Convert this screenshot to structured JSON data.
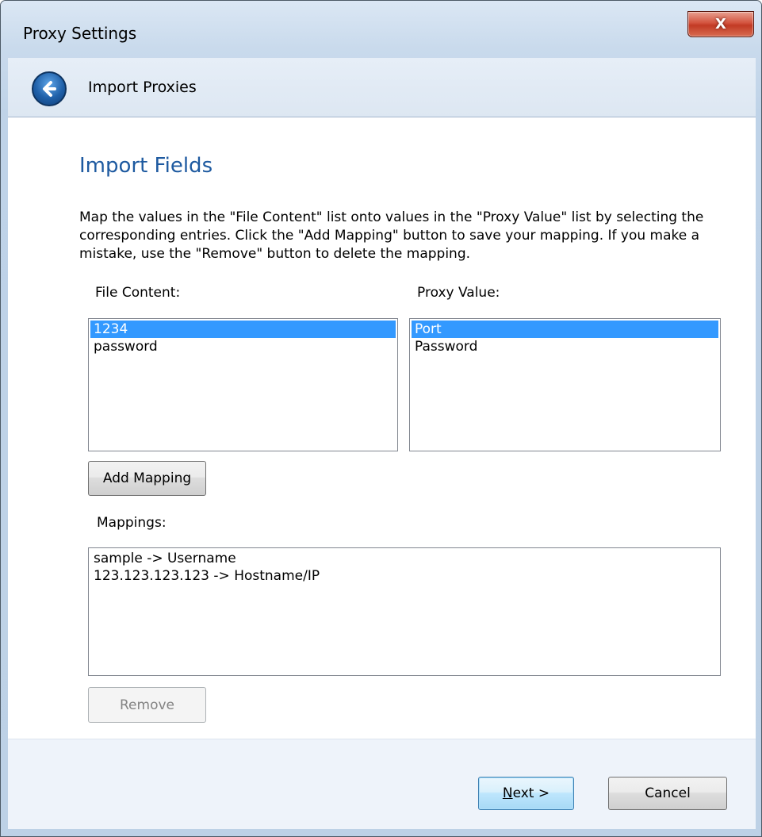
{
  "window": {
    "title": "Proxy Settings",
    "close_label": "X"
  },
  "nav": {
    "title": "Import Proxies",
    "back_icon": "back-arrow-icon"
  },
  "page": {
    "heading": "Import Fields",
    "description": "Map the values in the \"File Content\" list onto values in the \"Proxy Value\" list by selecting the corresponding entries. Click the \"Add Mapping\" button to save your mapping. If you make a mistake, use the \"Remove\" button to delete the mapping."
  },
  "file_content": {
    "label": "File Content:",
    "items": [
      "1234",
      "password"
    ],
    "selected_index": 0
  },
  "proxy_value": {
    "label": "Proxy Value:",
    "items": [
      "Port",
      "Password"
    ],
    "selected_index": 0
  },
  "add_mapping_label": "Add Mapping",
  "mappings": {
    "label": "Mappings:",
    "items": [
      "sample -> Username",
      "123.123.123.123 -> Hostname/IP"
    ]
  },
  "remove_label": "Remove",
  "footer": {
    "next_mnemonic": "N",
    "next_rest": "ext >",
    "cancel_label": "Cancel"
  },
  "colors": {
    "selection": "#3399ff",
    "heading": "#1e5aa0"
  }
}
